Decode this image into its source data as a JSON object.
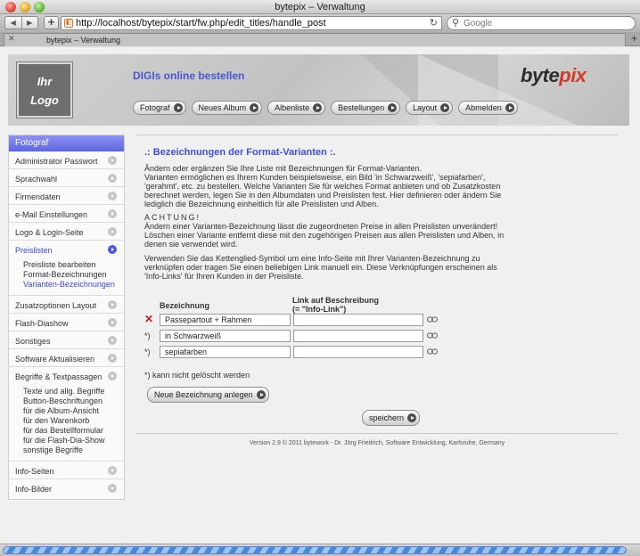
{
  "window": {
    "title": "bytepix – Verwaltung"
  },
  "browser": {
    "back_icon": "◀",
    "forward_icon": "▶",
    "add_icon": "+",
    "url": "http://localhost/bytepix/start/fw.php/edit_titles/handle_post",
    "search_placeholder": "Google",
    "tab_label": "bytepix – Verwaltung",
    "tab_close": "✕",
    "tab_new": "+",
    "reload_icon": "↻",
    "search_icon": "⚲"
  },
  "header": {
    "logo_line1": "Ihr",
    "logo_line2": "Logo",
    "slogan": "DIGIs online bestellen",
    "brand_part1": "byte",
    "brand_part2": "pix",
    "nav": [
      {
        "label": "Fotograf"
      },
      {
        "label": "Neues Album"
      },
      {
        "label": "Albenliste"
      },
      {
        "label": "Bestellungen"
      },
      {
        "label": "Layout"
      },
      {
        "label": "Abmelden"
      }
    ]
  },
  "sidebar": {
    "heading": "Fotograf",
    "items_top": [
      {
        "label": "Administrator Passwort"
      },
      {
        "label": "Sprachwahl"
      },
      {
        "label": "Firmendaten"
      },
      {
        "label": "e-Mail Einstellungen"
      },
      {
        "label": "Logo & Login-Seite"
      }
    ],
    "active": "Preislisten",
    "active_sub": [
      "Preisliste bearbeiten",
      "Format-Bezeichnungen",
      "Varianten-Bezeichnungen"
    ],
    "items_mid": [
      {
        "label": "Zusatzoptionen Layout"
      },
      {
        "label": "Flash-Diashow"
      },
      {
        "label": "Sonstiges"
      },
      {
        "label": "Software Aktualisieren"
      },
      {
        "label": "Begriffe & Textpassagen"
      }
    ],
    "begriffe_sub": [
      "Texte und allg. Begriffe",
      "Button-Beschriftungen",
      "für die Album-Ansicht",
      "für den Warenkorb",
      "für das Bestellformular",
      "für die Flash-Dia-Show",
      "sonstige Begriffe"
    ],
    "items_bottom": [
      {
        "label": "Info-Seiten"
      },
      {
        "label": "Info-Bilder"
      }
    ]
  },
  "main": {
    "title": ".: Bezeichnungen der Format-Varianten :.",
    "intro_lines": [
      "Ändern oder ergänzen Sie Ihre Liste mit Bezeichnungen für Format-Varianten.",
      "Varianten ermöglichen es Ihrem Kunden beispielsweise, ein Bild 'in Schwarzweiß', 'sepiafarben',",
      "'gerahmt', etc. zu bestellen. Welche Varianten Sie für welches Format anbieten und ob Zusatzkosten",
      "berechnet werden, legen Sie in den Albumdaten und Preislisten fest. Hier definieren oder ändern Sie",
      "lediglich die Bezeichnung einheitlich für alle Preislisten und Alben."
    ],
    "warning_title": "ACHTUNG!",
    "warning_lines": [
      "Ändern einer Varianten-Bezeichnung lässt die zugeordneten Preise in allen Preislisten unverändert!",
      "Löschen einer Variante entfernt diese mit den zugehörigen Preisen aus allen Preislisten und Alben, in",
      "denen sie verwendet wird."
    ],
    "info_lines": [
      "Verwenden Sie das Kettenglied-Symbol um eine Info-Seite mit Ihrer Varianten-Bezeichnung zu",
      "verknüpfen oder tragen Sie einen beliebigen Link manuell ein. Diese Verknüpfungen erscheinen als",
      "'Info-Links' für Ihren Kunden in der Preisliste."
    ],
    "col_name": "Bezeichnung",
    "col_link_1": "Link auf Beschreibung",
    "col_link_2": "(= \"Info-Link\")",
    "rows": [
      {
        "mark": "✕",
        "name": "Passepartout + Rahmen",
        "link": ""
      },
      {
        "mark": "*)",
        "name": "in Schwarzweiß",
        "link": ""
      },
      {
        "mark": "*)",
        "name": "sepiafarben",
        "link": ""
      }
    ],
    "note": "*) kann nicht gelöscht werden",
    "add_button": "Neue Bezeichnung anlegen",
    "save_button": "speichern",
    "footer": "Version 2.9 © 2011 bytework - Dr. Jörg Friedrich, Software Entwicklung, Karlsruhe, Germany"
  },
  "status": {
    "progress_fraction": 1.0
  }
}
